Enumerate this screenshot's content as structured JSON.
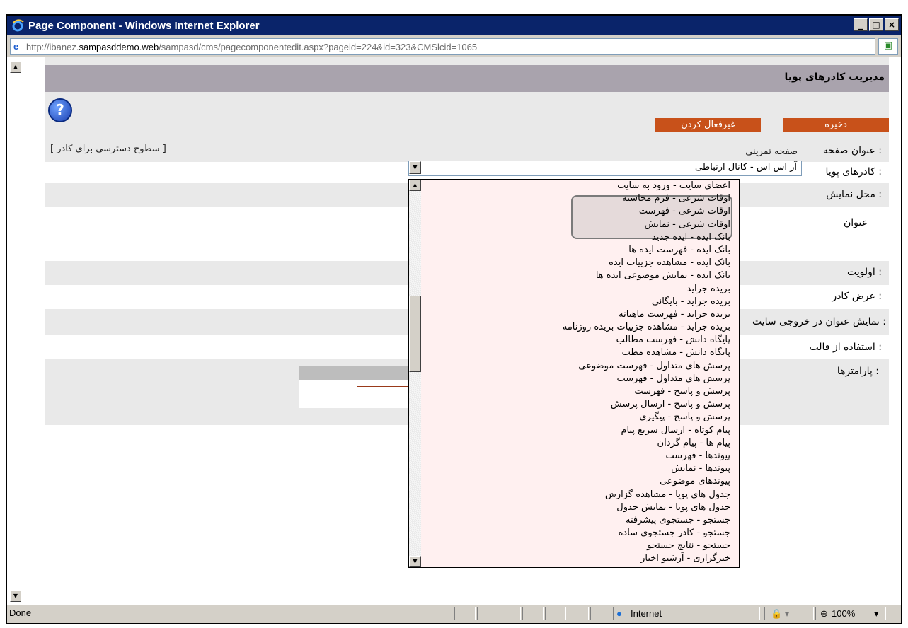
{
  "window": {
    "title": "Page Component - Windows Internet Explorer",
    "buttons": {
      "minimize": "_",
      "maximize": "□",
      "close": "×"
    }
  },
  "address": {
    "prefix": "http://ibanez.",
    "host": "sampasddemo.web",
    "path": "/sampasd/cms/pagecomponentedit.aspx?pageid=224&id=323&CMSlcid=1065"
  },
  "page": {
    "header": "مدیریت کادرهای پویا",
    "save_label": "ذخیره",
    "disable_label": "غیرفعال کردن",
    "access_levels": "[ سطوح دسترسی برای کادر ]"
  },
  "form": {
    "page_title_label": "عنوان صفحه :",
    "page_title_value": "صفحه تمرینی",
    "dynamic_frames_label": "کادرهای پویا :",
    "dynamic_frames_value": "آر اس اس - کانال ارتباطی",
    "display_location_label": "محل نمایش :",
    "title_label": "عنوان",
    "priority_label": "اولویت :",
    "frame_width_label": "عرض کادر :",
    "show_title_label": "نمایش عنوان در خروجی سایت :",
    "use_template_label": "استفاده از قالب :",
    "parameters_label": "پارامترها :"
  },
  "dropdown_items": [
    "اعضای سایت - ورود به سایت",
    "اوقات شرعی - فرم محاسبه",
    "اوقات شرعی - فهرست",
    "اوقات شرعی - نمایش",
    "بانک ایده - ایده جدید",
    "بانک ایده - فهرست ایده ها",
    "بانک ایده - مشاهده جزییات ایده",
    "بانک ایده - نمایش موضوعی ایده ها",
    "بریده جراید",
    "بریده جراید - بایگانی",
    "بریده جراید - فهرست ماهیانه",
    "بریده جراید - مشاهده جزییات بریده روزنامه",
    "پایگاه دانش - فهرست مطالب",
    "پایگاه دانش - مشاهده مطب",
    "پرسش های متداول - فهرست موضوعی",
    "پرسش های متداول - فهرست",
    "پرسش و پاسخ - فهرست",
    "پرسش و پاسخ - ارسال پرسش",
    "پرسش و پاسخ - پیگیری",
    "پیام کوتاه - ارسال سریع پیام",
    "پیام ها - پیام گردان",
    "پیوندها - فهرست",
    "پیوندها - نمایش",
    "پیوندهای موضوعی",
    "جدول های پویا - مشاهده گزارش",
    "جدول های پویا - نمایش جدول",
    "جستجو - جستجوی پیشرفته",
    "جستجو - کادر جستجوی ساده",
    "جستجو - نتایج جستجو",
    "خبرگزاری - آرشیو اخبار"
  ],
  "status": {
    "text": "Done",
    "zone": "Internet",
    "zoom": "100%"
  },
  "colors": {
    "accent_button": "#c8511a",
    "title_bar": "#0a246a",
    "header_band": "#a9a3ad"
  }
}
